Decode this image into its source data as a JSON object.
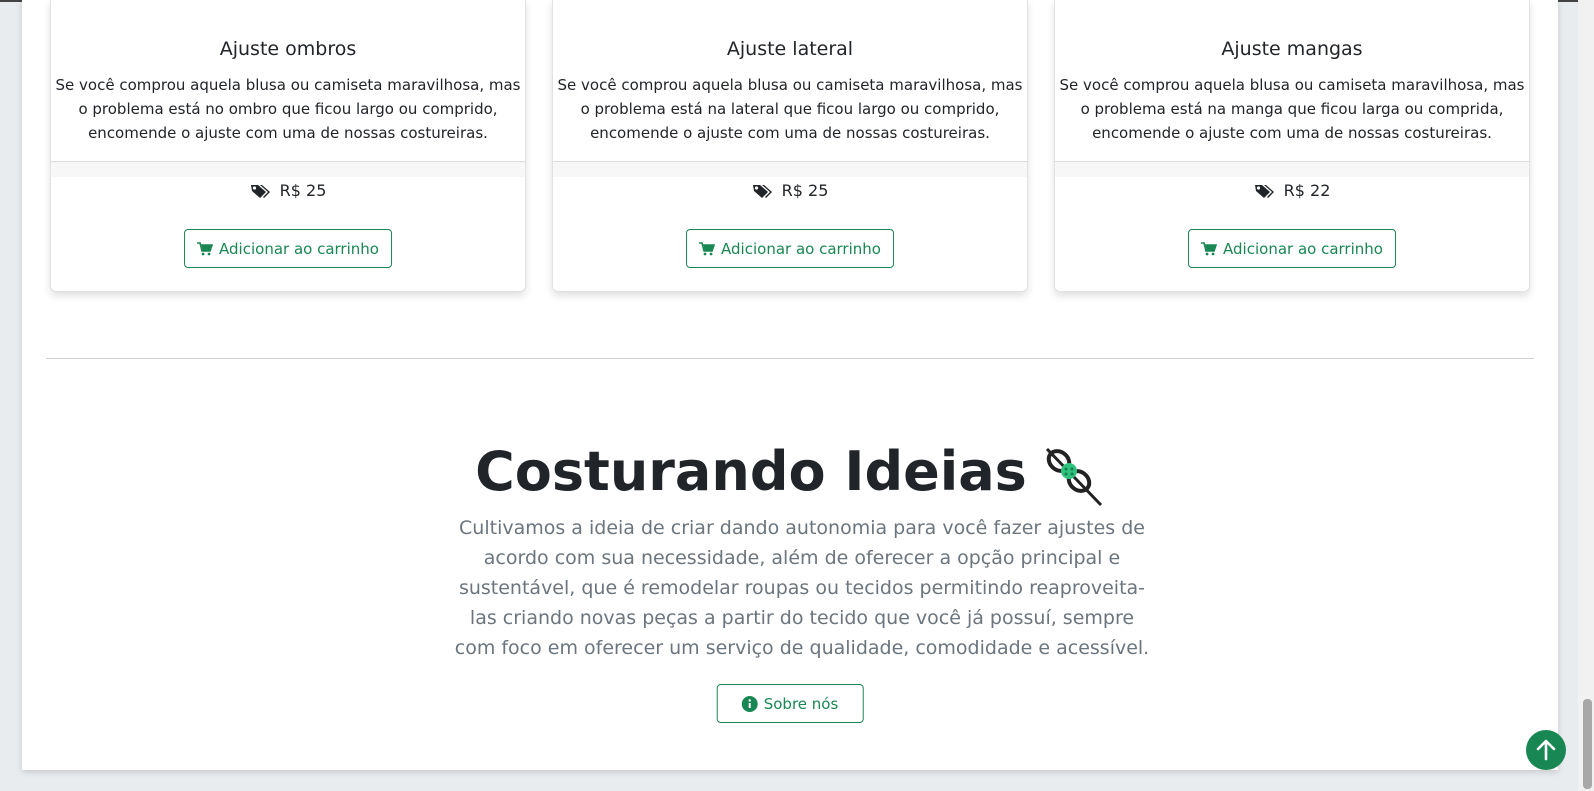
{
  "cards": [
    {
      "title": "Ajuste ombros",
      "text": "Se você comprou aquela blusa ou camiseta maravilhosa, mas o problema está no ombro que ficou largo ou comprido, encomende o ajuste com uma de nossas costureiras.",
      "price": "R$ 25",
      "button": "Adicionar ao carrinho"
    },
    {
      "title": "Ajuste lateral",
      "text": "Se você comprou aquela blusa ou camiseta maravilhosa, mas o problema está na lateral que ficou largo ou comprido, encomende o ajuste com uma de nossas costureiras.",
      "price": "R$ 25",
      "button": "Adicionar ao carrinho"
    },
    {
      "title": "Ajuste mangas",
      "text": "Se você comprou aquela blusa ou camiseta maravilhosa, mas o problema está na manga que ficou larga ou comprida, encomende o ajuste com uma de nossas costureiras.",
      "price": "R$ 22",
      "button": "Adicionar ao carrinho"
    }
  ],
  "about": {
    "title": "Costurando Ideias",
    "text": "Cultivamos a ideia de criar dando autonomia para você fazer ajustes de acordo com sua necessidade, além de oferecer a opção principal e sustentável, que é remodelar roupas ou tecidos permitindo reaproveita-las criando novas peças a partir do tecido que você já possuí, sempre com foco em oferecer um serviço de qualidade, comodidade e acessível.",
    "button": "Sobre nós"
  },
  "icons": {
    "tag": "tags-icon",
    "cart": "cart-icon",
    "info": "info-circle-icon",
    "needle": "needle-thread-icon",
    "scroll_top": "arrow-up-icon"
  },
  "colors": {
    "accent": "#198754",
    "text": "#212529",
    "muted": "#6c757d"
  }
}
